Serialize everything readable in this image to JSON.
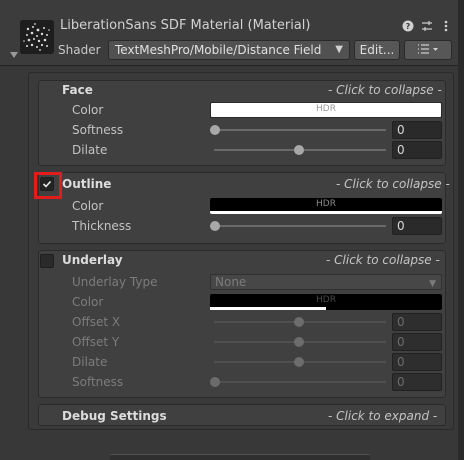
{
  "header": {
    "title": "LiberationSans SDF Material (Material)",
    "shader_label": "Shader",
    "shader_value": "TextMeshPro/Mobile/Distance Field",
    "edit_label": "Edit...",
    "icons": [
      "help-icon",
      "settings-sliders-icon",
      "kebab-menu-icon"
    ]
  },
  "face": {
    "title": "Face",
    "link": "- Click to collapse -",
    "color_label": "Color",
    "color_hdr": "HDR",
    "color_value": "#ffffff",
    "softness_label": "Softness",
    "softness_value": "0",
    "dilate_label": "Dilate",
    "dilate_value": "0"
  },
  "outline": {
    "title": "Outline",
    "link": "- Click to collapse -",
    "enabled": true,
    "color_label": "Color",
    "color_hdr": "HDR",
    "color_value": "#000000",
    "thickness_label": "Thickness",
    "thickness_value": "0"
  },
  "underlay": {
    "title": "Underlay",
    "link": "- Click to collapse -",
    "enabled": false,
    "type_label": "Underlay Type",
    "type_value": "None",
    "color_label": "Color",
    "color_hdr": "HDR",
    "color_value": "#000000",
    "offset_x_label": "Offset X",
    "offset_x_value": "0",
    "offset_y_label": "Offset Y",
    "offset_y_value": "0",
    "dilate_label": "Dilate",
    "dilate_value": "0",
    "softness_label": "Softness",
    "softness_value": "0"
  },
  "debug": {
    "title": "Debug Settings",
    "link": "- Click to expand -"
  }
}
